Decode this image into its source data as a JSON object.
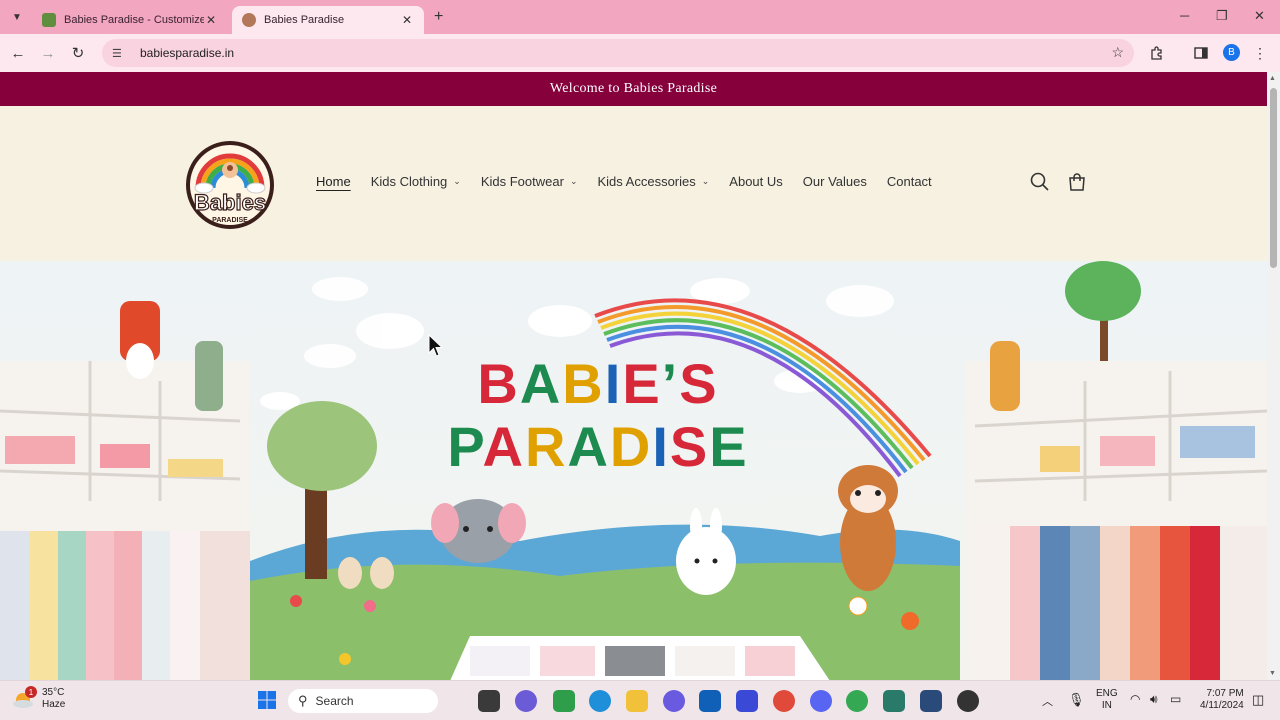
{
  "browser": {
    "tabs": [
      {
        "title": "Babies Paradise - Customize Cr",
        "active": false,
        "favicon_color": "#5e8e3e"
      },
      {
        "title": "Babies Paradise",
        "active": true,
        "favicon_color": "#b3785a"
      }
    ],
    "url": "babiesparadise.in",
    "profile_initial": "B"
  },
  "site": {
    "announcement": "Welcome to Babies Paradise",
    "logo": {
      "word": "Babies",
      "sub": "PARADISE"
    },
    "nav": [
      {
        "label": "Home",
        "dropdown": false,
        "active": true
      },
      {
        "label": "Kids Clothing",
        "dropdown": true,
        "active": false
      },
      {
        "label": "Kids Footwear",
        "dropdown": true,
        "active": false
      },
      {
        "label": "Kids Accessories",
        "dropdown": true,
        "active": false
      },
      {
        "label": "About Us",
        "dropdown": false,
        "active": false
      },
      {
        "label": "Our Values",
        "dropdown": false,
        "active": false
      },
      {
        "label": "Contact",
        "dropdown": false,
        "active": false
      }
    ],
    "hero": {
      "line1": [
        "B",
        "A",
        "B",
        "I",
        "E",
        "’",
        "S"
      ],
      "line2": [
        "P",
        "A",
        "R",
        "A",
        "D",
        "I",
        "S",
        "E"
      ],
      "line1_colors": [
        "#d62839",
        "#1d8a4f",
        "#e0a100",
        "#1a62b5",
        "#d62839",
        "#1d8a4f",
        "#d62839"
      ],
      "line2_colors": [
        "#1d8a4f",
        "#d62839",
        "#e0a100",
        "#1d8a4f",
        "#e0a100",
        "#1a62b5",
        "#d62839",
        "#1d8a4f"
      ]
    }
  },
  "colors": {
    "tabbar": "#f3a6c0",
    "announcement_bg": "#86003c",
    "header_bg": "#f6f1e1"
  },
  "taskbar": {
    "weather_temp": "35°C",
    "weather_desc": "Haze",
    "weather_badge": "1",
    "search_label": "Search",
    "lang_line1": "ENG",
    "lang_line2": "IN",
    "time": "7:07 PM",
    "date": "4/11/2024"
  }
}
